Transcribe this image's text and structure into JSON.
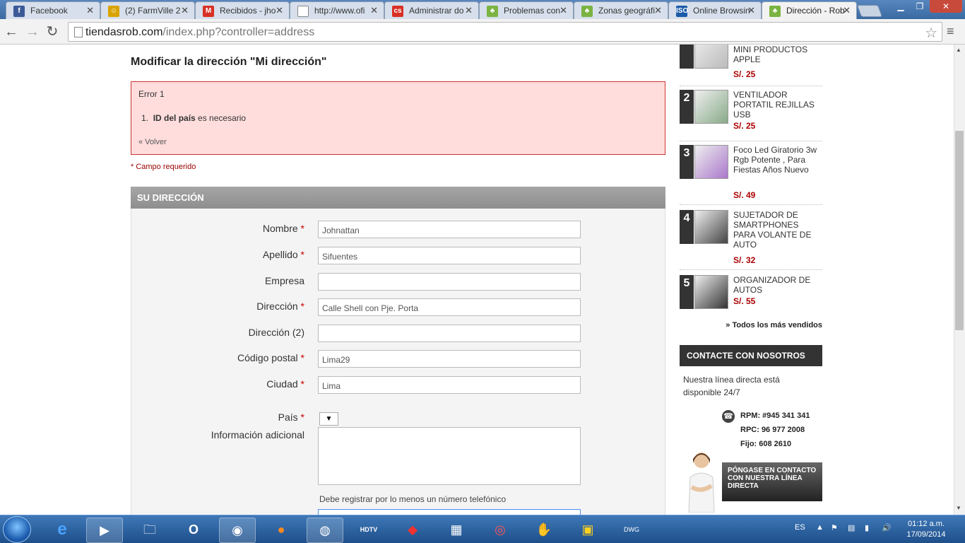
{
  "tabs": [
    {
      "title": "Facebook",
      "icon": "f",
      "color": "#3b5998"
    },
    {
      "title": "(2) FarmVille 2",
      "icon": "☺",
      "color": "#d9a300"
    },
    {
      "title": "Recibidos - jho",
      "icon": "M",
      "color": "#d93025"
    },
    {
      "title": "http://www.ofi",
      "icon": "",
      "color": "#ffffff"
    },
    {
      "title": "Administrar do",
      "icon": "cs",
      "color": "#d93025"
    },
    {
      "title": "Problemas con",
      "icon": "♣",
      "color": "#7bb342"
    },
    {
      "title": "Zonas geográfi",
      "icon": "♣",
      "color": "#7bb342"
    },
    {
      "title": "Online Browsin",
      "icon": "ISO",
      "color": "#1a5aa8"
    },
    {
      "title": "Dirección - Rob",
      "icon": "♣",
      "color": "#7bb342"
    }
  ],
  "browser": {
    "url_host": "tiendasrob.com",
    "url_path": "/index.php?controller=address"
  },
  "page": {
    "title": "Modificar la dirección \"Mi dirección\"",
    "error": {
      "title": "Error 1",
      "item_number": "1.",
      "item_bold": "ID del país",
      "item_rest": " es necesario",
      "back": "« Volver"
    },
    "required_note": "* Campo requerido",
    "section_title": "SU DIRECCIÓN",
    "fields": [
      {
        "label": "Nombre",
        "required": true,
        "value": "Johnattan"
      },
      {
        "label": "Apellido",
        "required": true,
        "value": "Sifuentes"
      },
      {
        "label": "Empresa",
        "required": false,
        "value": ""
      },
      {
        "label": "Dirección",
        "required": true,
        "value": "Calle Shell con Pje. Porta"
      },
      {
        "label": "Dirección (2)",
        "required": false,
        "value": ""
      },
      {
        "label": "Código postal",
        "required": true,
        "value": "Lima29"
      },
      {
        "label": "Ciudad",
        "required": true,
        "value": "Lima"
      }
    ],
    "country_label": "País",
    "country_value": "",
    "additional_label": "Información adicional",
    "phone_note": "Debe registrar por lo menos un número telefónico",
    "required_mark": "*"
  },
  "sidebar": {
    "products": [
      {
        "rank": "",
        "name": "MINI PRODUCTOS APPLE",
        "price": "S/. 25"
      },
      {
        "rank": "2",
        "name": "VENTILADOR PORTATIL REJILLAS USB",
        "price": "S/. 25"
      },
      {
        "rank": "3",
        "name": "Foco Led Giratorio 3w Rgb Potente , Para Fiestas Años Nuevo",
        "price": "S/. 49"
      },
      {
        "rank": "4",
        "name": "SUJETADOR DE SMARTPHONES PARA VOLANTE DE AUTO",
        "price": "S/. 32"
      },
      {
        "rank": "5",
        "name": "ORGANIZADOR DE AUTOS",
        "price": "S/. 55"
      }
    ],
    "all_best": "» Todos los más vendidos",
    "contact_title": "CONTACTE CON NOSOTROS",
    "contact_text": "Nuestra línea directa está disponible 24/7",
    "rpm": "RPM: #945 341 341",
    "rpc": "RPC: 96 977 2008",
    "fijo": "Fijo: 608 2610",
    "contact_button": "PÓNGASE EN CONTACTO CON NUESTRA LÍNEA DIRECTA"
  },
  "taskbar": {
    "lang": "ES",
    "time": "01:12 a.m.",
    "date": "17/09/2014"
  }
}
